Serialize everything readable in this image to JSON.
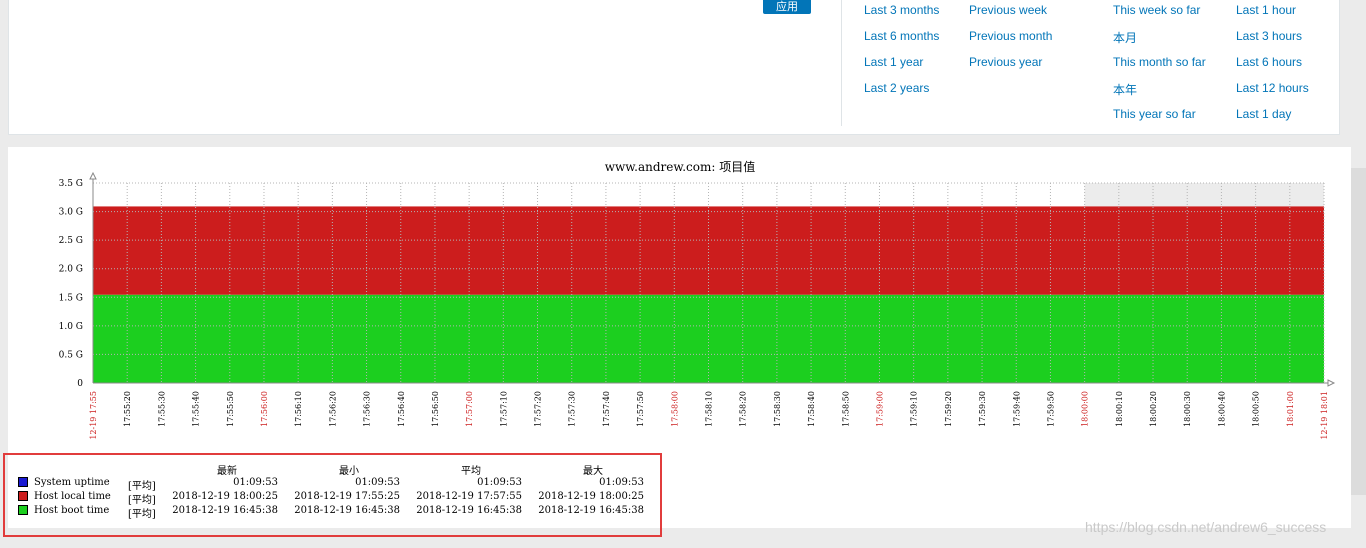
{
  "filter": {
    "apply_label": "应用",
    "col1": [
      "Last 3 months",
      "Last 6 months",
      "Last 1 year",
      "Last 2 years"
    ],
    "col2": [
      "Previous week",
      "Previous month",
      "Previous year"
    ],
    "col3": [
      "This week so far",
      "本月",
      "This month so far",
      "本年",
      "This year so far"
    ],
    "col4": [
      "Last 1 hour",
      "Last 3 hours",
      "Last 6 hours",
      "Last 12 hours",
      "Last 1 day"
    ]
  },
  "chart_data": {
    "type": "area",
    "title": "www.andrew.com: 项目值",
    "y_ticks": [
      "0",
      "0.5 G",
      "1.0 G",
      "1.5 G",
      "2.0 G",
      "2.5 G",
      "3.0 G",
      "3.5 G"
    ],
    "ylim": [
      0,
      3.5
    ],
    "stacked": true,
    "grid": true,
    "x_ticks": [
      "12-19 17:55",
      "17:55:20",
      "17:55:30",
      "17:55:40",
      "17:55:50",
      "17:56:00",
      "17:56:10",
      "17:56:20",
      "17:56:30",
      "17:56:40",
      "17:56:50",
      "17:57:00",
      "17:57:10",
      "17:57:20",
      "17:57:30",
      "17:57:40",
      "17:57:50",
      "17:58:00",
      "17:58:10",
      "17:58:20",
      "17:58:30",
      "17:58:40",
      "17:58:50",
      "17:59:00",
      "17:59:10",
      "17:59:20",
      "17:59:30",
      "17:59:40",
      "17:59:50",
      "18:00:00",
      "18:00:10",
      "18:00:20",
      "18:00:30",
      "18:00:40",
      "18:00:50",
      "18:01:00",
      "12-19 18:01"
    ],
    "x_ticks_red": [
      0,
      5,
      11,
      17,
      23,
      29,
      35,
      36
    ],
    "future_region_start_tick": 29,
    "series": [
      {
        "name": "System uptime",
        "color": "#1a1ad2",
        "value": 4.2e-06
      },
      {
        "name": "Host boot time",
        "color": "#1ccf1f",
        "value": 1.545
      },
      {
        "name": "Host local time",
        "color": "#cc1d1d",
        "value": 1.545
      }
    ]
  },
  "legend": {
    "headers": [
      "最新",
      "最小",
      "平均",
      "最大"
    ],
    "rows": [
      {
        "name": "System uptime",
        "color": "#1a1ad2",
        "func": "[平均]",
        "last": "01:09:53",
        "min": "01:09:53",
        "avg": "01:09:53",
        "max": "01:09:53"
      },
      {
        "name": "Host local time",
        "color": "#cc1d1d",
        "func": "[平均]",
        "last": "2018-12-19 18:00:25",
        "min": "2018-12-19 17:55:25",
        "avg": "2018-12-19 17:57:55",
        "max": "2018-12-19 18:00:25"
      },
      {
        "name": "Host boot time",
        "color": "#1ccf1f",
        "func": "[平均]",
        "last": "2018-12-19 16:45:38",
        "min": "2018-12-19 16:45:38",
        "avg": "2018-12-19 16:45:38",
        "max": "2018-12-19 16:45:38"
      }
    ]
  },
  "watermark": "https://blog.csdn.net/andrew6_success"
}
